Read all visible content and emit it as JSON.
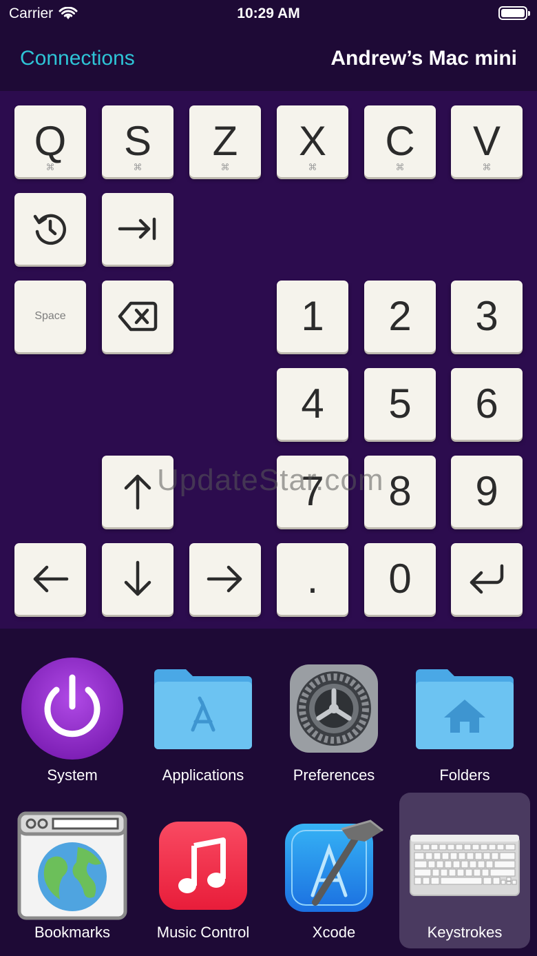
{
  "status_bar": {
    "carrier": "Carrier",
    "time": "10:29 AM",
    "wifi_icon": "wifi-icon",
    "battery_icon": "battery-icon"
  },
  "nav": {
    "back_label": "Connections",
    "title": "Andrew’s Mac mini"
  },
  "keys": {
    "row1": [
      {
        "label": "Q",
        "modifier": "⌘"
      },
      {
        "label": "S",
        "modifier": "⌘"
      },
      {
        "label": "Z",
        "modifier": "⌘"
      },
      {
        "label": "X",
        "modifier": "⌘"
      },
      {
        "label": "C",
        "modifier": "⌘"
      },
      {
        "label": "V",
        "modifier": "⌘"
      }
    ],
    "refresh_icon": "refresh-icon",
    "tab_icon": "tab-icon",
    "space_label": "Space",
    "backspace_icon": "backspace-icon",
    "digits": [
      "1",
      "2",
      "3",
      "4",
      "5",
      "6",
      "7",
      "8",
      "9",
      "0"
    ],
    "period": ".",
    "arrow_up_icon": "arrow-up-icon",
    "arrow_left_icon": "arrow-left-icon",
    "arrow_down_icon": "arrow-down-icon",
    "arrow_right_icon": "arrow-right-icon",
    "return_icon": "return-icon"
  },
  "watermark": "UpdateStar.com",
  "launcher": {
    "items": [
      {
        "label": "System",
        "icon": "power-icon"
      },
      {
        "label": "Applications",
        "icon": "applications-folder-icon"
      },
      {
        "label": "Preferences",
        "icon": "preferences-gear-icon"
      },
      {
        "label": "Folders",
        "icon": "home-folder-icon"
      },
      {
        "label": "Bookmarks",
        "icon": "browser-globe-icon"
      },
      {
        "label": "Music Control",
        "icon": "music-icon"
      },
      {
        "label": "Xcode",
        "icon": "xcode-icon"
      },
      {
        "label": "Keystrokes",
        "icon": "keyboard-icon",
        "selected": true
      }
    ]
  },
  "colors": {
    "accent": "#2ec4d6",
    "key_background": "#f5f3ec",
    "keypad_background": "#2c0c4e",
    "header_background": "#1e0a36",
    "selected_tile": "#4a3a60"
  }
}
